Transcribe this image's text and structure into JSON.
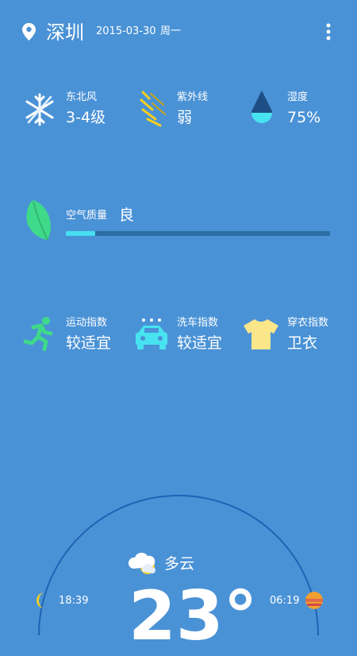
{
  "header": {
    "city": "深圳",
    "date": "2015-03-30",
    "weekday": "周一"
  },
  "conditions": {
    "wind": {
      "label": "东北风",
      "value": "3-4级",
      "icon": "snowflake-wind-icon"
    },
    "uv": {
      "label": "紫外线",
      "value": "弱",
      "icon": "uv-rays-icon"
    },
    "humidity": {
      "label": "湿度",
      "value": "75%",
      "icon": "water-drop-icon"
    }
  },
  "air": {
    "label": "空气质量",
    "value": "良",
    "level_fraction": 0.11,
    "icon": "leaf-icon"
  },
  "indices": {
    "sport": {
      "label": "运动指数",
      "value": "较适宜",
      "icon": "running-person-icon"
    },
    "carwash": {
      "label": "洗车指数",
      "value": "较适宜",
      "icon": "car-rain-icon"
    },
    "dressing": {
      "label": "穿衣指数",
      "value": "卫衣",
      "icon": "tshirt-icon"
    }
  },
  "forecast": {
    "condition": "多云",
    "temperature": "23°",
    "moonrise": "18:39",
    "sunrise": "06:19"
  },
  "colors": {
    "background": "#4a92d6",
    "accent": "#46e0f0",
    "leaf": "#3fd98a",
    "sun": "#f0a030"
  }
}
